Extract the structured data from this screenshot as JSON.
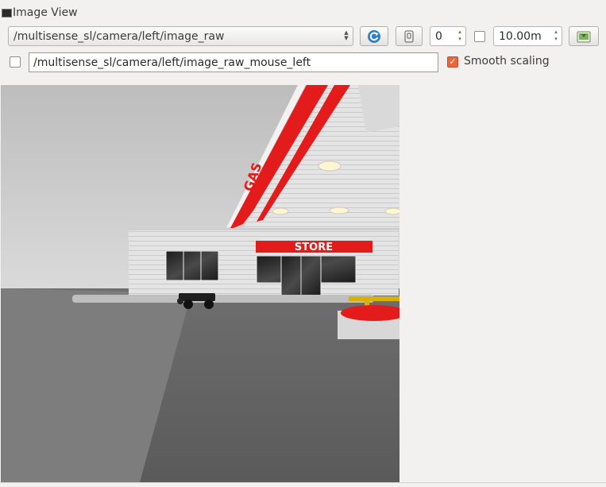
{
  "window": {
    "title": "Image View"
  },
  "toolbar": {
    "topic": "/multisense_sl/camera/left/image_raw",
    "rotation_value": "0",
    "distance_value": "10.00m",
    "mouse_topic": "/multisense_sl/camera/left/image_raw_mouse_left",
    "smooth_label": "Smooth scaling",
    "smooth_checked": true,
    "publish_checked": false,
    "distance_checked": false
  },
  "scene": {
    "sign_text": "STORE",
    "side_sign_text": "GAS"
  },
  "colors": {
    "accent": "#e9663a",
    "refresh_blue": "#2f80c9",
    "sign_red": "#e31b1b"
  }
}
